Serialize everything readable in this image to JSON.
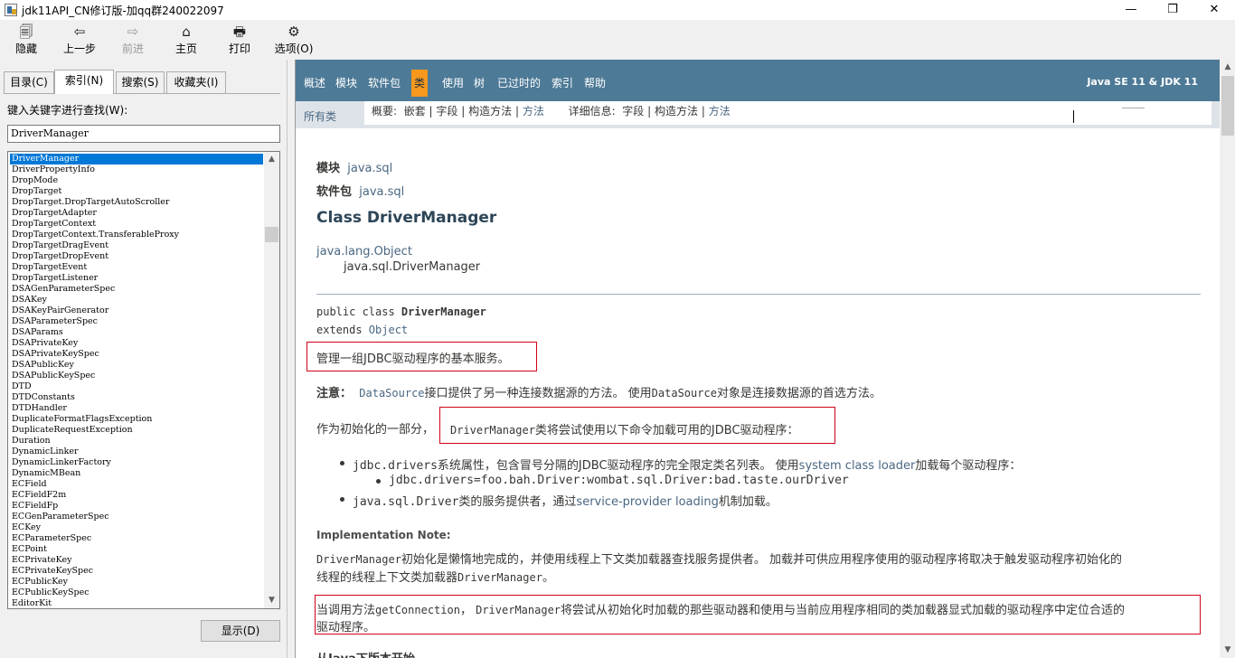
{
  "window": {
    "title": "jdk11API_CN修订版-加qq群240022097",
    "minimize": "—",
    "maximize": "❐",
    "close": "✕"
  },
  "toolbar": {
    "hide": "隐藏",
    "back": "上一步",
    "forward": "前进",
    "home": "主页",
    "print": "打印",
    "options": "选项(O)",
    "icons": {
      "hide": "🗐",
      "back": "⇦",
      "forward": "⇨",
      "home": "⌂",
      "print": "🖶",
      "options": "⚙"
    }
  },
  "left": {
    "tabs": [
      "目录(C)",
      "索引(N)",
      "搜索(S)",
      "收藏夹(I)"
    ],
    "keyword_label": "键入关键字进行查找(W):",
    "keyword_value": "DriverManager",
    "items": [
      "DriverManager",
      "DriverPropertyInfo",
      "DropMode",
      "DropTarget",
      "DropTarget.DropTargetAutoScroller",
      "DropTargetAdapter",
      "DropTargetContext",
      "DropTargetContext.TransferableProxy",
      "DropTargetDragEvent",
      "DropTargetDropEvent",
      "DropTargetEvent",
      "DropTargetListener",
      "DSAGenParameterSpec",
      "DSAKey",
      "DSAKeyPairGenerator",
      "DSAParameterSpec",
      "DSAParams",
      "DSAPrivateKey",
      "DSAPrivateKeySpec",
      "DSAPublicKey",
      "DSAPublicKeySpec",
      "DTD",
      "DTDConstants",
      "DTDHandler",
      "DuplicateFormatFlagsException",
      "DuplicateRequestException",
      "Duration",
      "DynamicLinker",
      "DynamicLinkerFactory",
      "DynamicMBean",
      "ECField",
      "ECFieldF2m",
      "ECFieldFp",
      "ECGenParameterSpec",
      "ECKey",
      "ECParameterSpec",
      "ECPoint",
      "ECPrivateKey",
      "ECPrivateKeySpec",
      "ECPublicKey",
      "ECPublicKeySpec",
      "EditorKit"
    ],
    "display_button": "显示(D)"
  },
  "nav": {
    "items": [
      "概述",
      "模块",
      "软件包",
      "类",
      "使用",
      "树",
      "已过时的",
      "索引",
      "帮助"
    ],
    "active_index": 3,
    "version": "Java SE 11 & JDK 11",
    "all_classes": "所有类",
    "summary_label": "概要:",
    "summary_nested": "嵌套",
    "summary_field": "字段",
    "summary_constr": "构造方法",
    "summary_method": "方法",
    "detail_label": "详细信息:",
    "detail_field": "字段",
    "detail_constr": "构造方法",
    "detail_method": "方法",
    "sep": "|"
  },
  "doc": {
    "module_label": "模块",
    "module_value": "java.sql",
    "package_label": "软件包",
    "package_value": "java.sql",
    "class_title": "Class DriverManager",
    "inherit_parent": "java.lang.Object",
    "inherit_child": "java.sql.DriverManager",
    "decl_prefix": "public class ",
    "decl_name": "DriverManager",
    "decl_extends": "extends ",
    "decl_super": "Object",
    "desc": "管理一组JDBC驱动程序的基本服务。",
    "note_label": "注意：",
    "note_link": "DataSource",
    "note_text1": "接口提供了另一种连接数据源的方法。 使用",
    "note_code": "DataSource",
    "note_text2": "对象是连接数据源的首选方法。",
    "init_prefix": "作为初始化的一部分，",
    "init_code": "DriverManager",
    "init_text": "类将尝试使用以下命令加载可用的JDBC驱动程序：",
    "b1_code": "jdbc.drivers",
    "b1_text": "系统属性，包含冒号分隔的JDBC驱动程序的完全限定类名列表。 使用",
    "b1_link": "system class loader",
    "b1_text2": "加载每个驱动程序：",
    "b1_sub": "jdbc.drivers=foo.bah.Driver:wombat.sql.Driver:bad.taste.ourDriver",
    "b2_code": "java.sql.Driver",
    "b2_text": "类的服务提供者，通过",
    "b2_link": "service-provider loading",
    "b2_text2": "机制加载。",
    "impl_note": "Implementation Note:",
    "impl_code1": "DriverManager",
    "impl_text1": "初始化是懒惰地完成的，并使用线程上下文类加载器查找服务提供者。 加载并可供应用程序使用的驱动程序将取决于触发驱动程序初始化的",
    "impl_text2": "线程的线程上下文类加载器",
    "impl_code2": "DriverManager",
    "impl_text3": "。",
    "conn_text1": "当调用方法",
    "conn_code1": "getConnection",
    "conn_text2": "，",
    "conn_code2": "DriverManager",
    "conn_text3": "将尝试从初始化时加载的那些驱动器和使用与当前应用程序相同的类加载器显式加载的驱动程序中定位合适的",
    "conn_text4": "驱动程序。",
    "partial": "从Java下版本开始"
  }
}
